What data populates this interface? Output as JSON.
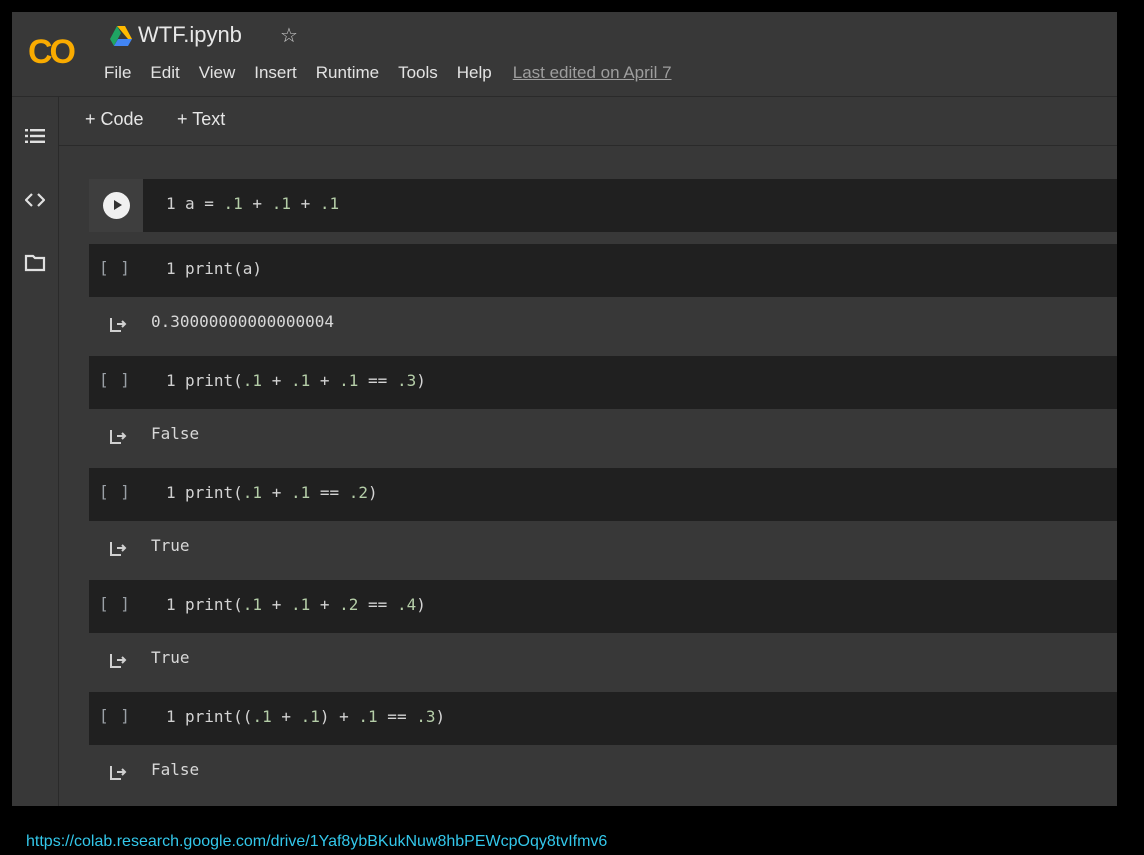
{
  "header": {
    "logo_text": "CO",
    "title": "WTF.ipynb",
    "menu": [
      "File",
      "Edit",
      "View",
      "Insert",
      "Runtime",
      "Tools",
      "Help"
    ],
    "last_edited": "Last edited on April 7"
  },
  "toolbar": {
    "add_code_label": "+ Code",
    "add_text_label": "+ Text"
  },
  "left_rail": {
    "icons": [
      "table-of-contents-icon",
      "code-snippets-icon",
      "files-icon"
    ]
  },
  "cells": [
    {
      "prompt": "",
      "line": "1",
      "code": "a = .1 + .1 + .1",
      "output": null
    },
    {
      "prompt": "[ ]",
      "line": "1",
      "code": "print(a)",
      "output": "0.30000000000000004"
    },
    {
      "prompt": "[ ]",
      "line": "1",
      "code": "print(.1 + .1 + .1 == .3)",
      "output": "False"
    },
    {
      "prompt": "[ ]",
      "line": "1",
      "code": "print(.1 + .1 == .2)",
      "output": "True"
    },
    {
      "prompt": "[ ]",
      "line": "1",
      "code": "print(.1 + .1 + .2 == .4)",
      "output": "True"
    },
    {
      "prompt": "[ ]",
      "line": "1",
      "code": "print((.1 + .1) + .1 == .3)",
      "output": "False"
    }
  ],
  "footer": {
    "url": "https://colab.research.google.com/drive/1Yaf8ybBKukNuw8hbPEWcpOqy8tvIfmv6"
  },
  "colors": {
    "background": "#383838",
    "cell": "#202020",
    "logo": "#f9ab00",
    "link": "#33c7ea"
  }
}
